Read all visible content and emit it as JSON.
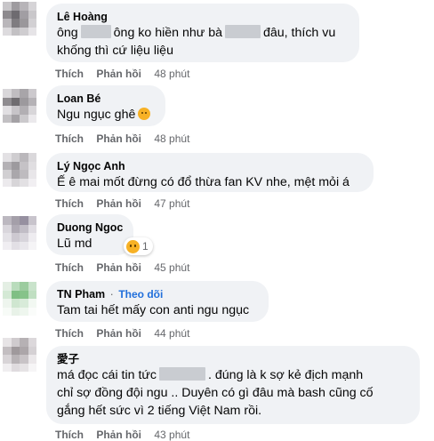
{
  "comments": [
    {
      "author": "Lê Hoàng",
      "line1a": "ông",
      "line1b": "ông ko hiền như bà",
      "line1c": "đâu, thích vu",
      "line2": "khống thì cứ liệu liệu",
      "like": "Thích",
      "reply": "Phản hồi",
      "time": "48 phút"
    },
    {
      "author": "Loan Bé",
      "line1": "Ngu ngục ghê",
      "emoji": "grimace-emoji",
      "like": "Thích",
      "reply": "Phản hồi",
      "time": "48 phút"
    },
    {
      "author": "Lý Ngọc Anh",
      "line1": "Ế ê mai mốt đừng có đổ thừa fan KV nhe, mệt mỏi á",
      "like": "Thích",
      "reply": "Phản hồi",
      "time": "47 phút"
    },
    {
      "author": "Duong Ngoc",
      "line1": "Lũ md",
      "reaction_icon": "sad-reaction-icon",
      "reaction_count": "1",
      "like": "Thích",
      "reply": "Phản hồi",
      "time": "45 phút"
    },
    {
      "author": "TN Pham",
      "separator": "·",
      "follow": "Theo dõi",
      "line1": "Tam tai hết mấy con anti ngu ngục",
      "like": "Thích",
      "reply": "Phản hồi",
      "time": "44 phút"
    },
    {
      "author": "愛子",
      "line1a": "má đọc cái tin tức",
      "line1b": ". đúng là k sợ kẻ địch mạnh",
      "line2": "chỉ sợ đồng đội ngu .. Duyên có gì đâu mà bash cũng cố",
      "line3": "gắng hết sức vì 2 tiếng Việt Nam rồi.",
      "like": "Thích",
      "reply": "Phản hồi",
      "time": "43 phút"
    }
  ]
}
